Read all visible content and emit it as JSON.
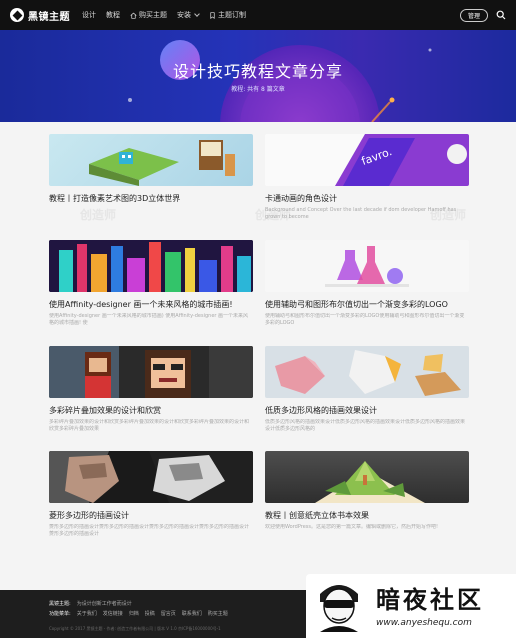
{
  "nav": {
    "logo_text": "黑镜主题",
    "items": [
      "设计",
      "教程",
      "购买主题",
      "安装",
      "主题订制"
    ],
    "manage_label": "管理"
  },
  "hero": {
    "title": "设计技巧教程文章分享",
    "subtitle": "教程: 共有 8 篇文章"
  },
  "cards": [
    {
      "title": "教程丨打造像素艺术图的3D立体世界",
      "excerpt": ""
    },
    {
      "title": "卡通动画的角色设计",
      "excerpt": "Background and Concept Over the last decade if dom developer Hamoff has grown to become",
      "image_text": "favro."
    },
    {
      "title": "使用Affinity-designer 画一个未来风格的城市插画!",
      "excerpt": "使用Affinity-designer 画一个未来风格的城市插画) 使用Affinity-designer 画一个未来风格的城市插画! 使"
    },
    {
      "title": "使用辅助弓和图形布尔值切出一个渐变多彩的LOGO",
      "excerpt": "使用辅助弓和图形布尔值切出一个渐变多彩的LOGO使用辅助弓和图形布尔值切出一个渐变多彩的LOGO"
    },
    {
      "title": "多彩碎片叠加效果的设计和欣赏",
      "excerpt": "多彩碎片叠加效果的设计和欣赏多彩碎片叠加效果的设计和欣赏多彩碎片叠加效果的设计和欣赏多彩碎片叠加效果"
    },
    {
      "title": "低质多边形风格的插画效果设计",
      "excerpt": "低质多边形风格的插画效果设计低质多边形风格的插画效果设计低质多边形风格的插画效果设计低质多边形风格的"
    },
    {
      "title": "菱形多边形的插画设计",
      "excerpt": "菱形多边形的插画设计菱形多边形的插画设计菱形多边形的插画设计菱形多边形的插画设计菱形多边形的插画设计"
    },
    {
      "title": "教程丨创意纸壳立体书本效果",
      "excerpt": "欢迎使用WordPress。这是您的第一篇文章。编辑或删除它，然后开始写作吧!"
    }
  ],
  "watermark": "创造师",
  "footer": {
    "row1_label": "黑镜主题:",
    "row1_text": "为设计创新工作者而设计",
    "row2_label": "功能菜单:",
    "row2_links": [
      "关于我们",
      "发信链接",
      "归档",
      "投稿",
      "留言页",
      "联系我们",
      "购买主题"
    ],
    "copyright": "Copyright © 2017 黑镜主题 - 作者: 创造工作者有限公司 | 版本 V 1.0 京ICP备16000000号-1"
  },
  "badge": {
    "name": "暗夜社区",
    "url": "www.anyeshequ.com"
  },
  "colors": {
    "nav_bg": "#111111",
    "hero_bg": "#2433b8",
    "page_bg": "#f4f4f4",
    "footer_bg": "#1e1e1e"
  }
}
